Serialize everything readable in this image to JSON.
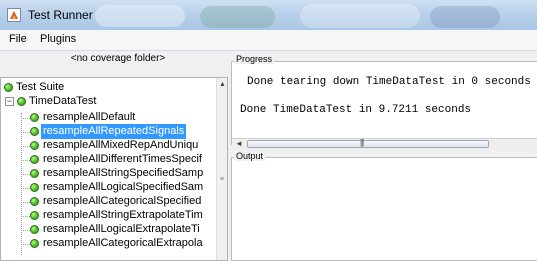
{
  "window": {
    "title": "Test Runner"
  },
  "menu": {
    "items": [
      "File",
      "Plugins"
    ]
  },
  "coverage": {
    "label": "<no coverage folder>"
  },
  "tree": {
    "root": "Test Suite",
    "group": "TimeDataTest",
    "items": [
      "resampleAllDefault",
      "resampleAllRepeatedSignals",
      "resampleAllMixedRepAndUniqu",
      "resampleAllDifferentTimesSpecif",
      "resampleAllStringSpecifiedSamp",
      "resampleAllLogicalSpecifiedSam",
      "resampleAllCategoricalSpecified",
      "resampleAllStringExtrapolateTim",
      "resampleAllLogicalExtrapolateTi",
      "resampleAllCategoricalExtrapola"
    ],
    "selected_index": 1
  },
  "progress": {
    "label": "Progress",
    "line1": "Done tearing down TimeDataTest in 0 seconds",
    "line2": "Done TimeDataTest in 9.7211 seconds"
  },
  "output": {
    "label": "Output"
  },
  "colors": {
    "status_pass": "#5cc63a",
    "selection": "#3399ff"
  }
}
